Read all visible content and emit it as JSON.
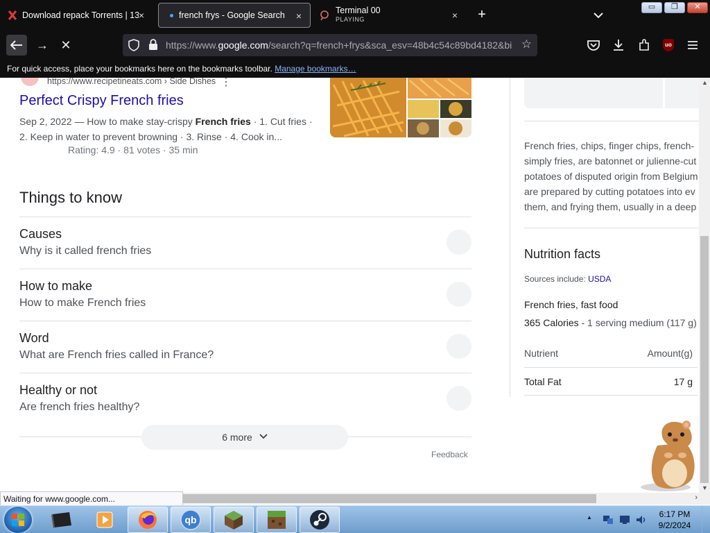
{
  "tabs": [
    {
      "title": "Download repack Torrents | 13",
      "close": "×"
    },
    {
      "title": "french frys - Google Search",
      "close": "×"
    },
    {
      "title": "Terminal 00",
      "subtitle": "PLAYING",
      "close": "×"
    }
  ],
  "new_tab": "+",
  "window_controls": {
    "minimize": "▭",
    "maximize": "❐",
    "close": "✕"
  },
  "nav": {
    "back": "back-arrow",
    "forward": "→",
    "stop": "✕"
  },
  "address_bar": {
    "url_prefix": "https://www.",
    "url_domain": "google.com",
    "url_rest": "/search?q=french+frys&sca_esv=48b4c54c89bd4182&bi",
    "star": "☆"
  },
  "bookmarks_bar": {
    "message": "For quick access, place your bookmarks here on the bookmarks toolbar.",
    "link": "Manage bookmarks…"
  },
  "result": {
    "url": "https://www.recipetineats.com › Side Dishes",
    "menu": "⋮",
    "title": "Perfect Crispy French fries",
    "snippet_pre": "Sep 2, 2022 — How to make stay-crispy ",
    "snippet_bold": "French fries",
    "snippet_post": " · 1. Cut fries · 2. Keep in water to prevent browning · 3. Rinse · 4. Cook in...",
    "rating": "Rating: 4.9 · 81 votes · 35 min"
  },
  "things_to_know": {
    "heading": "Things to know",
    "items": [
      {
        "title": "Causes",
        "sub": "Why is it called french fries"
      },
      {
        "title": "How to make",
        "sub": "How to make French fries"
      },
      {
        "title": "Word",
        "sub": "What are French fries called in France?"
      },
      {
        "title": "Healthy or not",
        "sub": "Are french fries healthy?"
      }
    ],
    "more": "6 more",
    "more_chevron": "⌄",
    "feedback": "Feedback"
  },
  "knowledge_panel": {
    "description": [
      "French fries, chips, finger chips, french-",
      "simply fries, are batonnet or julienne-cut",
      "potatoes of disputed origin from Belgium",
      "are prepared by cutting potatoes into ev",
      "them, and frying them, usually in a deep"
    ],
    "nutrition_title": "Nutrition facts",
    "sources_label": "Sources include: ",
    "sources_link": "USDA",
    "food": "French fries, fast food",
    "calories": "365 Calories",
    "serving": " - 1 serving medium (117 g)",
    "col_nutrient": "Nutrient",
    "col_amount": "Amount(g)",
    "row_name": "Total Fat",
    "row_value": "17 g"
  },
  "status_text": "Waiting for www.google.com...",
  "taskbar": {
    "time": "6:17 PM",
    "date": "9/2/2024",
    "tray_arrow": "▲"
  },
  "colors": {
    "link_blue": "#1a0dab",
    "chrome_dark": "#0f0f10",
    "urlbar": "#2b2a33",
    "taskbar": "#7fa9d6"
  }
}
